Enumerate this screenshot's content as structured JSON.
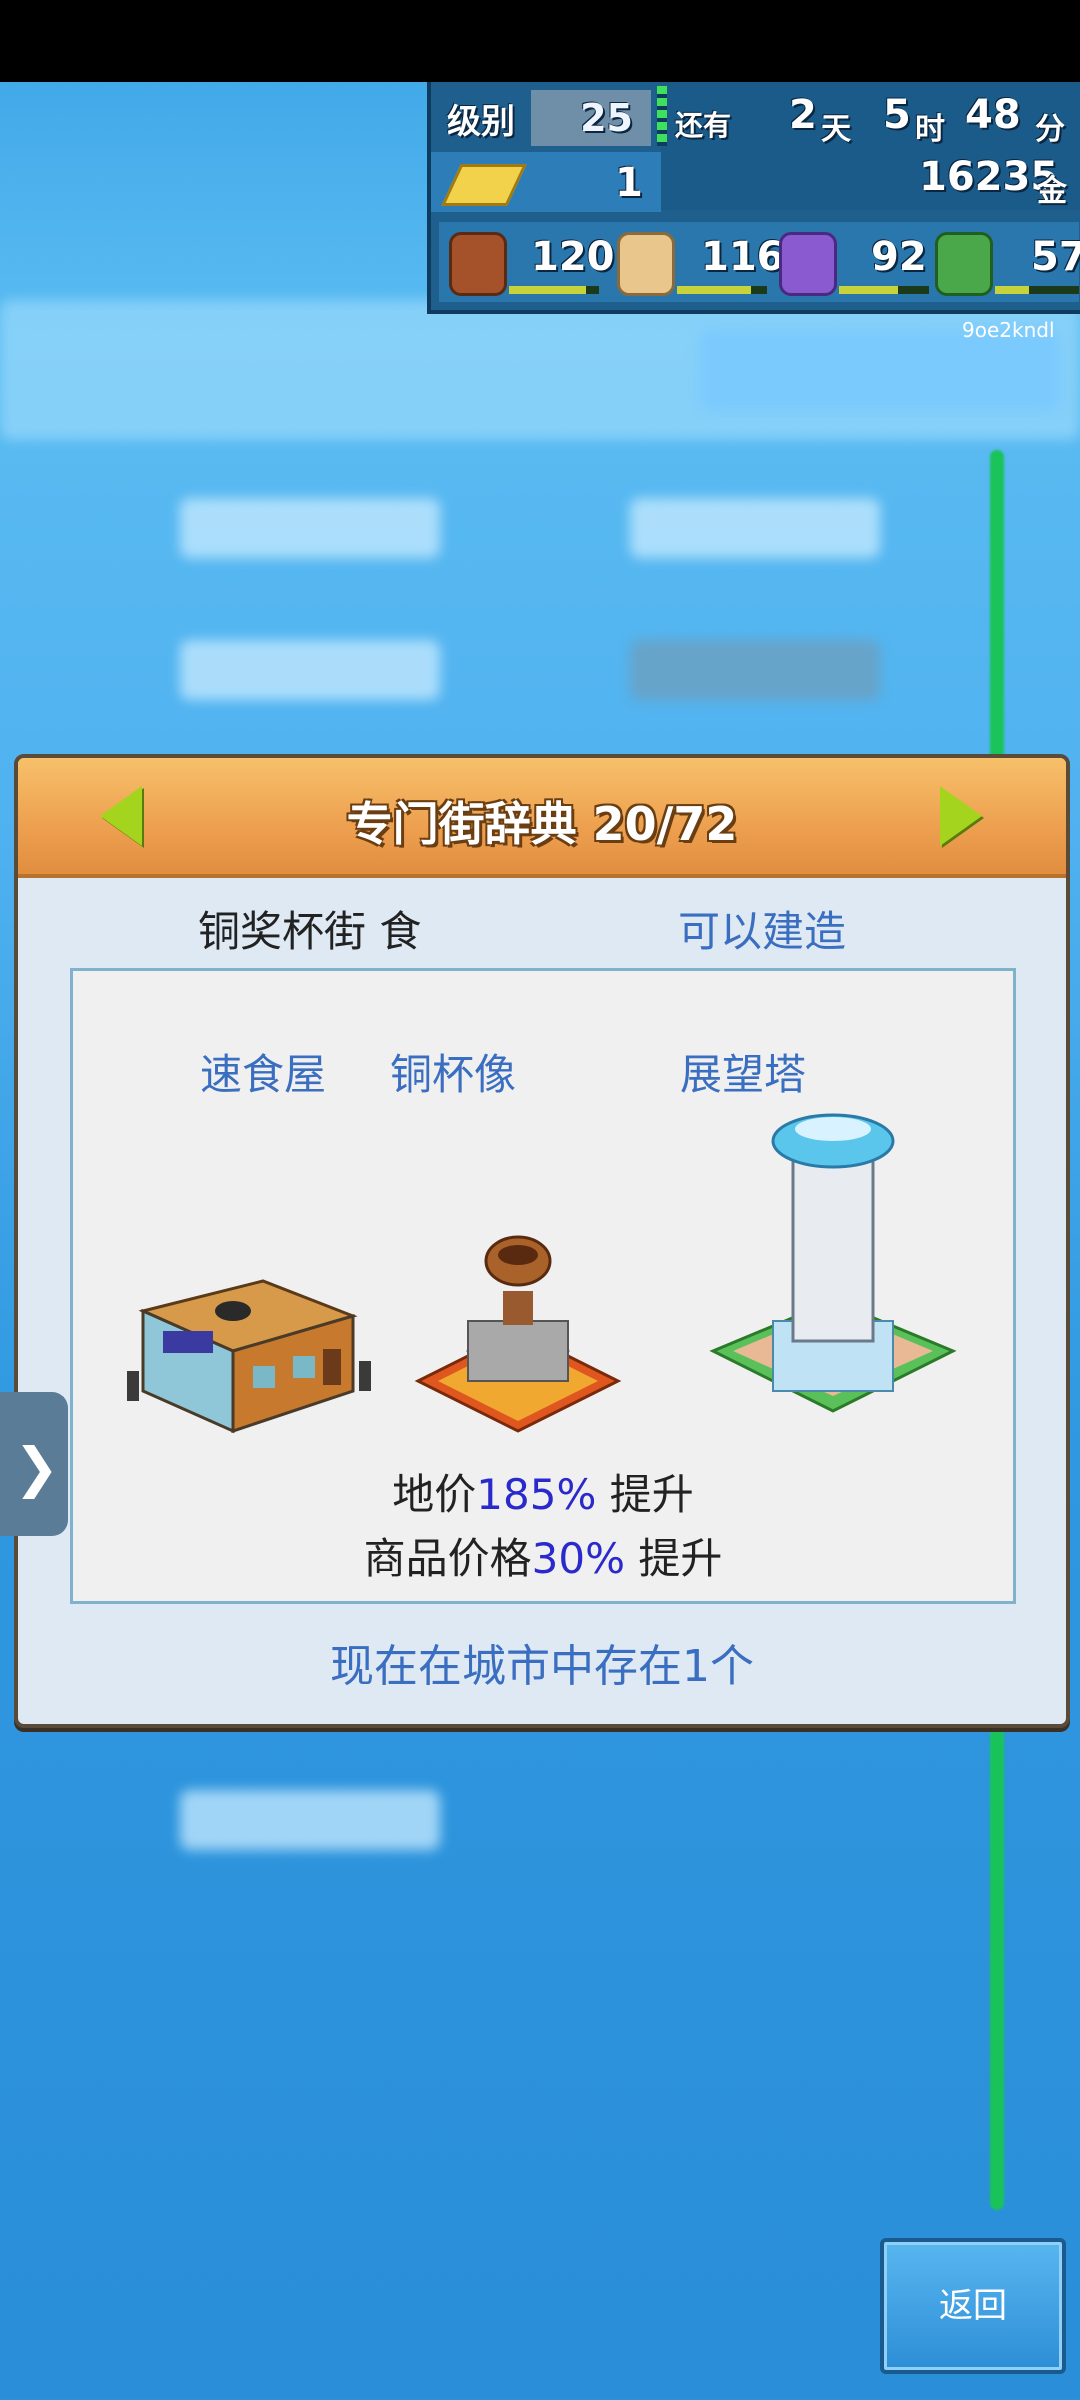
{
  "hud": {
    "level_label": "级别",
    "level_value": "25",
    "remaining_label": "还有",
    "days_value": "2",
    "days_unit": "天",
    "hours_value": "5",
    "hours_unit": "时",
    "minutes_value": "48",
    "minutes_unit": "分",
    "gold_bars": "1",
    "money_value": "16235",
    "money_unit": "金",
    "stats": [
      {
        "icon": "food-icon",
        "value": "120",
        "fill": 0.85
      },
      {
        "icon": "goods-icon",
        "value": "116",
        "fill": 0.82
      },
      {
        "icon": "music-icon",
        "value": "92",
        "fill": 0.65
      },
      {
        "icon": "book-icon",
        "value": "57",
        "fill": 0.4
      }
    ]
  },
  "user_id": "9oe2kndl",
  "dialog": {
    "title": "专门街辞典 20/72",
    "street_name": "铜奖杯街 食",
    "build_status": "可以建造",
    "buildings": [
      {
        "name": "速食屋",
        "icon": "fast-food-shop-icon"
      },
      {
        "name": "铜杯像",
        "icon": "bronze-trophy-statue-icon"
      },
      {
        "name": "展望塔",
        "icon": "observation-tower-icon"
      }
    ],
    "effect_land_prefix": "地价",
    "effect_land_value": "185%",
    "effect_land_suffix": " 提升",
    "effect_goods_prefix": "商品价格",
    "effect_goods_value": "30%",
    "effect_goods_suffix": " 提升",
    "exist_text": "现在在城市中存在1个"
  },
  "back_button": "返回",
  "colors": {
    "accent_blue": "#3a6ec0",
    "header_orange": "#eda04f",
    "arrow_green": "#a5d41e",
    "highlight_number": "#2a2acc"
  }
}
